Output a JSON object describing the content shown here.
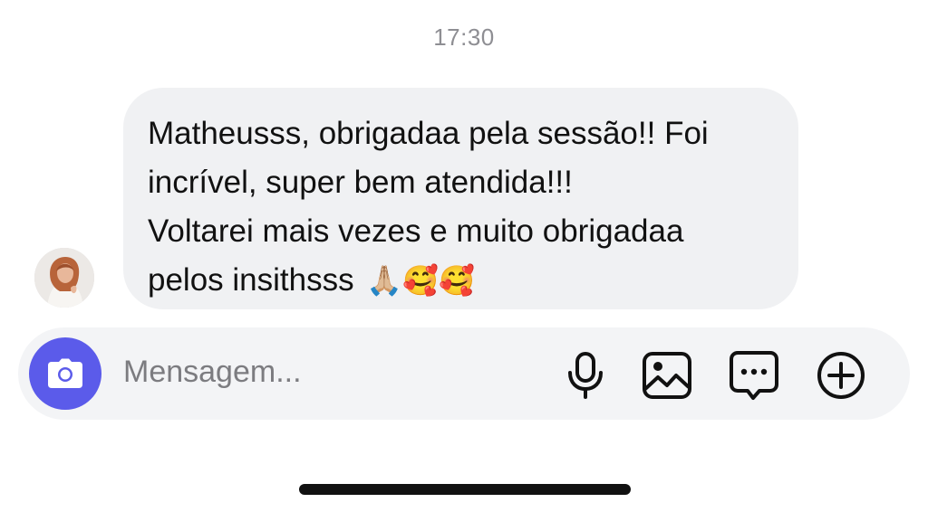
{
  "chat": {
    "timestamp": "17:30",
    "message": {
      "lines": [
        "Matheusss, obrigadaa pela sessão!! Foi",
        "incrível, super bem atendida!!!",
        "Voltarei mais vezes e muito obrigadaa",
        "pelos insithsss"
      ],
      "emojis": "🙏🏼🥰🥰"
    }
  },
  "composer": {
    "placeholder": "Mensagem...",
    "accent_color": "#5b5bea",
    "icons": [
      "camera-icon",
      "microphone-icon",
      "image-icon",
      "sticker-chat-icon",
      "plus-circle-icon"
    ]
  }
}
